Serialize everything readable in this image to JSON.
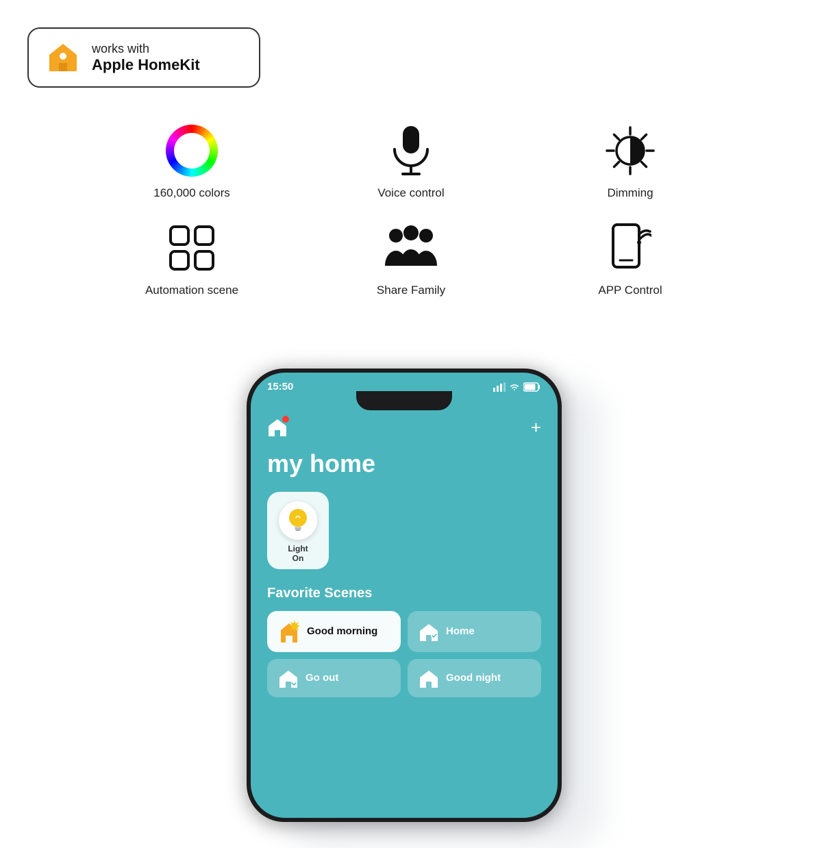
{
  "badge": {
    "works_with": "works with",
    "name": "Apple HomeKit"
  },
  "features": [
    {
      "id": "colors",
      "label": "160,000 colors",
      "icon_type": "color-wheel"
    },
    {
      "id": "voice",
      "label": "Voice control",
      "icon_type": "microphone"
    },
    {
      "id": "dimming",
      "label": "Dimming",
      "icon_type": "dimming"
    },
    {
      "id": "automation",
      "label": "Automation scene",
      "icon_type": "scene"
    },
    {
      "id": "family",
      "label": "Share Family",
      "icon_type": "family"
    },
    {
      "id": "app",
      "label": "APP Control",
      "icon_type": "app"
    }
  ],
  "phone": {
    "time": "15:50",
    "app_title": "my home",
    "device": {
      "label_line1": "Light",
      "label_line2": "On"
    },
    "scenes_title": "Favorite Scenes",
    "scenes": [
      {
        "id": "good-morning",
        "label": "Good morning",
        "style": "white"
      },
      {
        "id": "home",
        "label": "Home",
        "style": "teal"
      },
      {
        "id": "go-out",
        "label": "Go out",
        "style": "teal"
      },
      {
        "id": "good-night",
        "label": "Good night",
        "style": "teal"
      }
    ]
  }
}
